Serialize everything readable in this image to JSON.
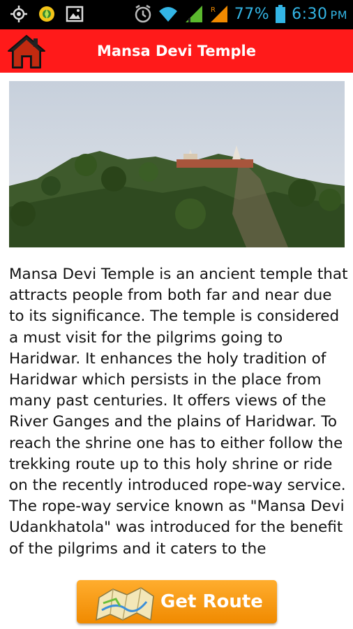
{
  "status_bar": {
    "battery": "77%",
    "time": "6:30",
    "ampm": "PM",
    "icons": [
      "gps-icon",
      "location-icon",
      "image-icon",
      "alarm-icon",
      "wifi-icon",
      "signal-icon",
      "roaming-signal-icon",
      "battery-icon"
    ],
    "accent_color": "#33b5e5"
  },
  "app_bar": {
    "title": "Mansa Devi Temple",
    "background_color": "#ff1a1a",
    "home_icon": "home-icon"
  },
  "hero_image": {
    "subject": "Hilltop temple surrounded by green trees"
  },
  "description": "Mansa Devi Temple is an ancient temple that attracts people from both far and near due to its significance. The temple is considered a must visit for the pilgrims going to Haridwar. It enhances the holy tradition of Haridwar which persists in the place from many past centuries. It offers views of the River Ganges and the plains of Haridwar. To reach the shrine one has to either follow the trekking route up to this holy shrine or ride on the recently introduced rope-way service. The rope-way service known as \"Mansa Devi Udankhatola\" was introduced for the benefit of the pilgrims and it caters to the",
  "route_button": {
    "label": "Get Route",
    "icon": "map-icon",
    "color": "#f7a11a"
  }
}
